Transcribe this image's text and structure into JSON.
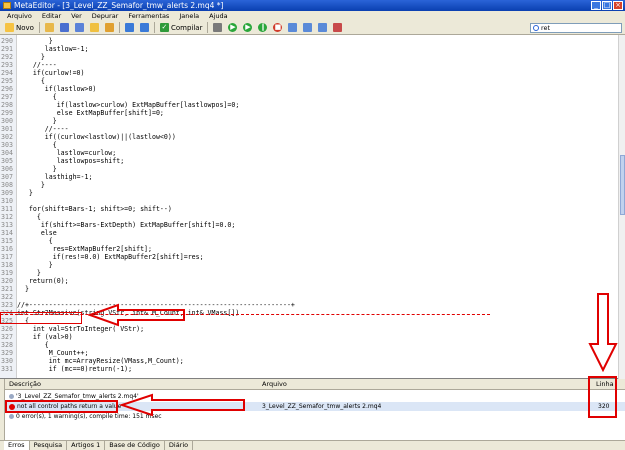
{
  "window": {
    "title": "MetaEditor - [3_Level_ZZ_Semafor_tmw_alerts 2.mq4 *]"
  },
  "menu": {
    "items": [
      "Arquivo",
      "Editar",
      "Ver",
      "Depurar",
      "Ferramentas",
      "Janela",
      "Ajuda"
    ]
  },
  "toolbar": {
    "novo_label": "Novo",
    "compile_label": "Compilar",
    "search_value": "ret"
  },
  "code": {
    "lines": [
      {
        "n": "290",
        "t": "        }"
      },
      {
        "n": "291",
        "t": "       lastlow=-1;"
      },
      {
        "n": "292",
        "t": "      }"
      },
      {
        "n": "293",
        "t": "    //----"
      },
      {
        "n": "294",
        "t": "    if(curlow!=0)"
      },
      {
        "n": "295",
        "t": "      {"
      },
      {
        "n": "296",
        "t": "       if(lastlow>0)"
      },
      {
        "n": "297",
        "t": "         {"
      },
      {
        "n": "298",
        "t": "          if(lastlow>curlow) ExtMapBuffer[lastlowpos]=0;"
      },
      {
        "n": "299",
        "t": "          else ExtMapBuffer[shift]=0;"
      },
      {
        "n": "300",
        "t": "         }"
      },
      {
        "n": "301",
        "t": "       //----"
      },
      {
        "n": "302",
        "t": "       if((curlow<lastlow)||(lastlow<0))"
      },
      {
        "n": "303",
        "t": "         {"
      },
      {
        "n": "304",
        "t": "          lastlow=curlow;"
      },
      {
        "n": "305",
        "t": "          lastlowpos=shift;"
      },
      {
        "n": "306",
        "t": "         }"
      },
      {
        "n": "307",
        "t": "       lasthigh=-1;"
      },
      {
        "n": "308",
        "t": "      }"
      },
      {
        "n": "309",
        "t": "   }"
      },
      {
        "n": "310",
        "t": ""
      },
      {
        "n": "311",
        "t": "   for(shift=Bars-1; shift>=0; shift--)"
      },
      {
        "n": "312",
        "t": "     {"
      },
      {
        "n": "313",
        "t": "      if(shift>=Bars-ExtDepth) ExtMapBuffer[shift]=0.0;"
      },
      {
        "n": "314",
        "t": "      else"
      },
      {
        "n": "315",
        "t": "        {"
      },
      {
        "n": "316",
        "t": "         res=ExtMapBuffer2[shift];"
      },
      {
        "n": "317",
        "t": "         if(res!=0.0) ExtMapBuffer2[shift]=res;"
      },
      {
        "n": "318",
        "t": "        }"
      },
      {
        "n": "319",
        "t": "     }"
      },
      {
        "n": "320",
        "t": "   return(0);"
      },
      {
        "n": "321",
        "t": "  }"
      },
      {
        "n": "322",
        "t": ""
      },
      {
        "n": "323",
        "t": "//+------------------------------------------------------------------+"
      },
      {
        "n": "324",
        "t": "int Str2Massive(string VStr, int& M_Count, int& VMass[])"
      },
      {
        "n": "325",
        "t": "  {"
      },
      {
        "n": "326",
        "t": "    int val=StrToInteger( VStr);"
      },
      {
        "n": "327",
        "t": "    if (val>0)"
      },
      {
        "n": "328",
        "t": "       {"
      },
      {
        "n": "329",
        "t": "        M_Count++;"
      },
      {
        "n": "330",
        "t": "        int mc=ArrayResize(VMass,M_Count);"
      },
      {
        "n": "331",
        "t": "        if (mc==0)return(-1);"
      }
    ]
  },
  "panel": {
    "headers": {
      "descricao": "Descrição",
      "arquivo": "Arquivo",
      "linha": "Linha"
    },
    "rows": [
      {
        "desc": "'3_Level_ZZ_Semafor_tmw_alerts 2.mq4'",
        "file": "",
        "line": ""
      },
      {
        "desc": "not all control paths return a value",
        "file": "3_Level_ZZ_Semafor_tmw_alerts 2.mq4",
        "line": "320"
      },
      {
        "desc": "0 error(s), 1 warning(s), compile time: 151 msec",
        "file": "",
        "line": ""
      }
    ],
    "tabs": [
      "Erros",
      "Pesquisa",
      "Artigos",
      "Base de Código",
      "Diário"
    ],
    "tab_badges": {
      "artigos": "1",
      "base": "1"
    }
  },
  "colors": {
    "annotation_red": "#e00000",
    "title_blue": "#0a3fb0"
  }
}
